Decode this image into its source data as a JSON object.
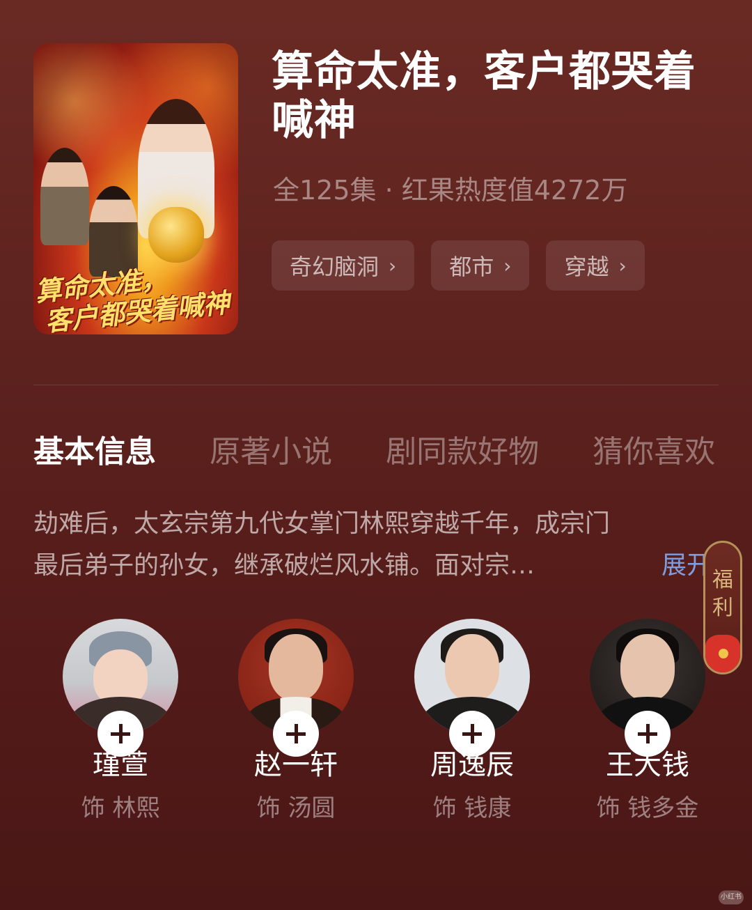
{
  "drama": {
    "title": "算命太准，客户都哭着喊神",
    "meta": "全125集 · 红果热度值4272万",
    "poster_title": [
      "算命太准，",
      "客户都哭着喊神"
    ]
  },
  "tags": [
    {
      "label": "奇幻脑洞",
      "chevron": "›"
    },
    {
      "label": "都市",
      "chevron": "›"
    },
    {
      "label": "穿越",
      "chevron": "›"
    }
  ],
  "tabs": [
    {
      "label": "基本信息",
      "active": true
    },
    {
      "label": "原著小说",
      "active": false
    },
    {
      "label": "剧同款好物",
      "active": false
    },
    {
      "label": "猜你喜欢",
      "active": false
    }
  ],
  "synopsis": {
    "line1": "劫难后，太玄宗第九代女掌门林熙穿越千年，成宗门",
    "line2": "最后弟子的孙女，继承破烂风水铺。面对宗…",
    "expand_label": "展开"
  },
  "gift_float": {
    "label": "福利"
  },
  "cast": [
    {
      "name": "瑾萱",
      "role": "饰 林熙",
      "avatar_icon": "actress-avatar"
    },
    {
      "name": "赵一轩",
      "role": "饰 汤圆",
      "avatar_icon": "actor-avatar"
    },
    {
      "name": "周逸辰",
      "role": "饰 钱康",
      "avatar_icon": "actor-avatar"
    },
    {
      "name": "王大钱",
      "role": "饰 钱多金",
      "avatar_icon": "actor-avatar"
    }
  ],
  "watermark": "小红书",
  "colors": {
    "background": "#5e231f",
    "expand_link": "#7f9dde",
    "gift_border": "#b4925a",
    "gift_envelope": "#d8332b"
  }
}
